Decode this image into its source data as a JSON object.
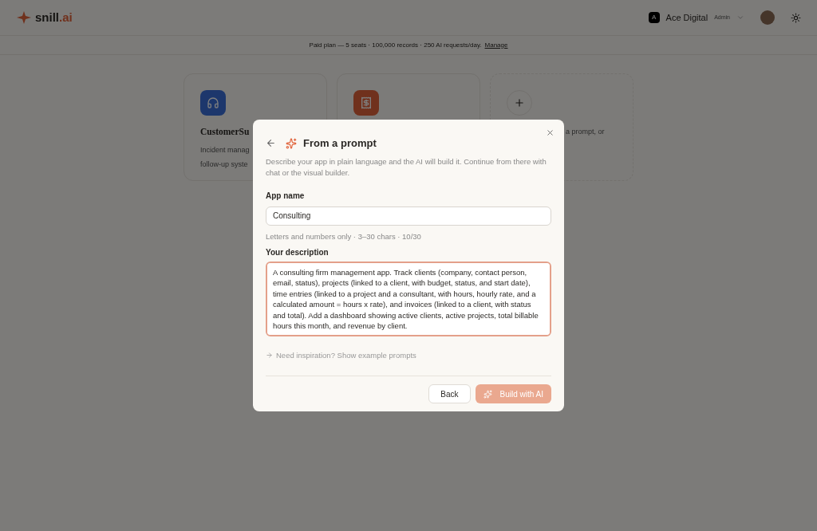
{
  "header": {
    "logo": "snill",
    "logo_suffix": ".ai",
    "workspace": {
      "initial": "A",
      "name": "Ace Digital",
      "role": "Admin"
    }
  },
  "plan_bar": {
    "text": "Paid plan — 5 seats · 100,000 records · 250 AI requests/day.",
    "link": "Manage"
  },
  "cards": [
    {
      "kind": "support",
      "title": "CustomerSu",
      "lines": [
        "Incident manag",
        "follow-up syste"
      ]
    },
    {
      "kind": "billing"
    },
    {
      "kind": "new",
      "lines": [
        "a prompt, or"
      ]
    }
  ],
  "dialog": {
    "title": "From a prompt",
    "description": "Describe your app in plain language and the AI will build it. Continue from there with chat or the visual builder.",
    "name_label": "App name",
    "name_value": "Consulting",
    "name_hint": "Letters and numbers only · 3–30 chars · 10/30",
    "description_label": "Your description",
    "description_value": "A consulting firm management app. Track clients (company, contact person, email, status), projects (linked to a client, with budget, status, and start date), time entries (linked to a project and a consultant, with hours, hourly rate, and a calculated amount = hours x rate), and invoices (linked to a client, with status and total). Add a dashboard showing active clients, active projects, total billable hours this month, and revenue by client.",
    "description_focused": true,
    "inspiration": "Need inspiration? Show example prompts",
    "back_button": "Back",
    "build_button": {
      "label": "Build with AI",
      "disabled": true
    }
  }
}
